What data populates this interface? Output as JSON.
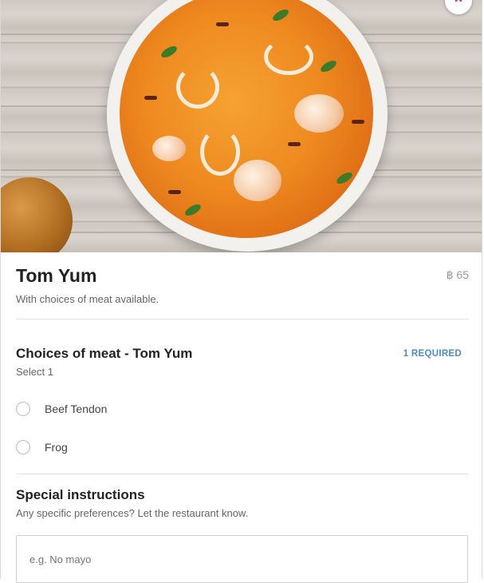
{
  "hero": {
    "image_alt": "Tom Yum soup photo"
  },
  "close_icon": "×",
  "item": {
    "name": "Tom Yum",
    "price": "฿ 65",
    "description": "With choices of meat available."
  },
  "choices": {
    "title": "Choices of meat - Tom Yum",
    "required_badge": "1 REQUIRED",
    "select_hint": "Select 1",
    "options": [
      {
        "label": "Beef Tendon",
        "selected": false
      },
      {
        "label": "Frog",
        "selected": false
      }
    ]
  },
  "special": {
    "title": "Special instructions",
    "hint": "Any specific preferences? Let the restaurant know.",
    "placeholder": "e.g. No mayo",
    "value": ""
  },
  "colors": {
    "accent_blue": "#4a8bd0",
    "close_red": "#d6284e"
  }
}
